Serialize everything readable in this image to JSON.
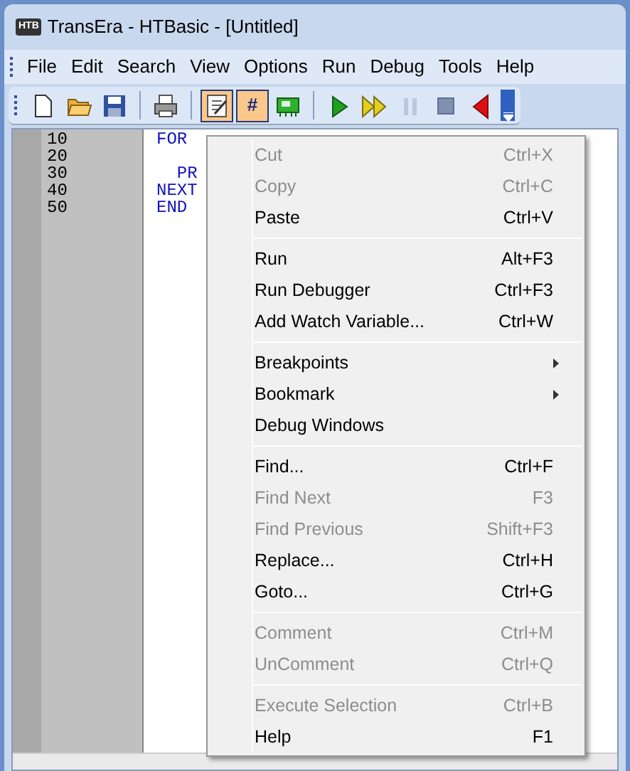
{
  "window": {
    "title": "TransEra - HTBasic - [Untitled]",
    "app_icon": "HTB"
  },
  "menu_bar": [
    {
      "label": "File"
    },
    {
      "label": "Edit"
    },
    {
      "label": "Search"
    },
    {
      "label": "View"
    },
    {
      "label": "Options"
    },
    {
      "label": "Run"
    },
    {
      "label": "Debug"
    },
    {
      "label": "Tools"
    },
    {
      "label": "Help"
    }
  ],
  "toolbar": [
    {
      "kind": "new"
    },
    {
      "kind": "open"
    },
    {
      "kind": "save"
    },
    {
      "kind": "sep"
    },
    {
      "kind": "print"
    },
    {
      "kind": "sep"
    },
    {
      "kind": "edit",
      "selected": true
    },
    {
      "kind": "hash",
      "label": "#",
      "selected": true
    },
    {
      "kind": "chip"
    },
    {
      "kind": "sep"
    },
    {
      "kind": "run"
    },
    {
      "kind": "step"
    },
    {
      "kind": "pause",
      "disabled": true
    },
    {
      "kind": "stop"
    },
    {
      "kind": "back"
    },
    {
      "kind": "more"
    }
  ],
  "editor": {
    "lines": [
      {
        "number": "10",
        "code": "FOR"
      },
      {
        "number": "20"
      },
      {
        "number": "30",
        "code": "  PR"
      },
      {
        "number": "40",
        "code": "NEXT"
      },
      {
        "number": "50",
        "code": "END"
      }
    ]
  },
  "context_menu": [
    {
      "kind": "item",
      "label": "Cut",
      "shortcut": "Ctrl+X",
      "disabled": true
    },
    {
      "kind": "item",
      "label": "Copy",
      "shortcut": "Ctrl+C",
      "disabled": true
    },
    {
      "kind": "item",
      "label": "Paste",
      "shortcut": "Ctrl+V",
      "disabled": false
    },
    {
      "kind": "separator"
    },
    {
      "kind": "item",
      "label": "Run",
      "shortcut": "Alt+F3",
      "disabled": false
    },
    {
      "kind": "item",
      "label": "Run Debugger",
      "shortcut": "Ctrl+F3",
      "disabled": false
    },
    {
      "kind": "item",
      "label": "Add Watch Variable...",
      "shortcut": "Ctrl+W",
      "disabled": false
    },
    {
      "kind": "separator"
    },
    {
      "kind": "submenu",
      "label": "Breakpoints",
      "disabled": false
    },
    {
      "kind": "submenu",
      "label": "Bookmark",
      "disabled": false
    },
    {
      "kind": "item",
      "label": "Debug Windows",
      "disabled": false
    },
    {
      "kind": "separator"
    },
    {
      "kind": "item",
      "label": "Find...",
      "shortcut": "Ctrl+F",
      "disabled": false
    },
    {
      "kind": "item",
      "label": "Find Next",
      "shortcut": "F3",
      "disabled": true
    },
    {
      "kind": "item",
      "label": "Find Previous",
      "shortcut": "Shift+F3",
      "disabled": true
    },
    {
      "kind": "item",
      "label": "Replace...",
      "shortcut": "Ctrl+H",
      "disabled": false
    },
    {
      "kind": "item",
      "label": "Goto...",
      "shortcut": "Ctrl+G",
      "disabled": false
    },
    {
      "kind": "separator"
    },
    {
      "kind": "item",
      "label": "Comment",
      "shortcut": "Ctrl+M",
      "disabled": true
    },
    {
      "kind": "item",
      "label": "UnComment",
      "shortcut": "Ctrl+Q",
      "disabled": true
    },
    {
      "kind": "separator"
    },
    {
      "kind": "item",
      "label": "Execute Selection",
      "shortcut": "Ctrl+B",
      "disabled": true
    },
    {
      "kind": "item",
      "label": "Help",
      "shortcut": "F1",
      "disabled": false
    }
  ]
}
